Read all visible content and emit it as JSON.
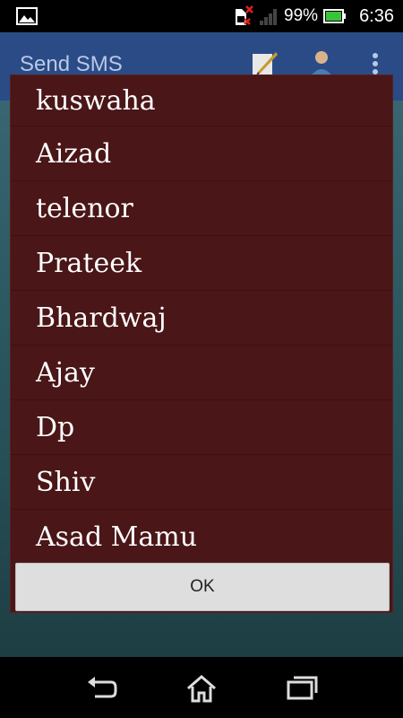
{
  "status_bar": {
    "battery_percent": "99%",
    "time": "6:36",
    "icons": [
      "image-notification-icon",
      "sim-missing-icon",
      "signal-icon",
      "battery-icon"
    ]
  },
  "action_bar": {
    "title": "Send SMS",
    "icons": [
      "compose-icon",
      "contacts-icon",
      "overflow-menu-icon"
    ]
  },
  "dialog": {
    "contacts": [
      "kuswaha",
      "Aizad",
      "telenor",
      "Prateek",
      "Bhardwaj",
      "Ajay",
      "Dp",
      "Shiv",
      "Asad Mamu"
    ],
    "ok_label": "OK"
  },
  "nav_bar": {
    "icons": [
      "back-icon",
      "home-icon",
      "recent-apps-icon"
    ]
  },
  "colors": {
    "dialog_background": "#4a1618",
    "action_bar": "#2a4b86",
    "button": "#dedede"
  }
}
